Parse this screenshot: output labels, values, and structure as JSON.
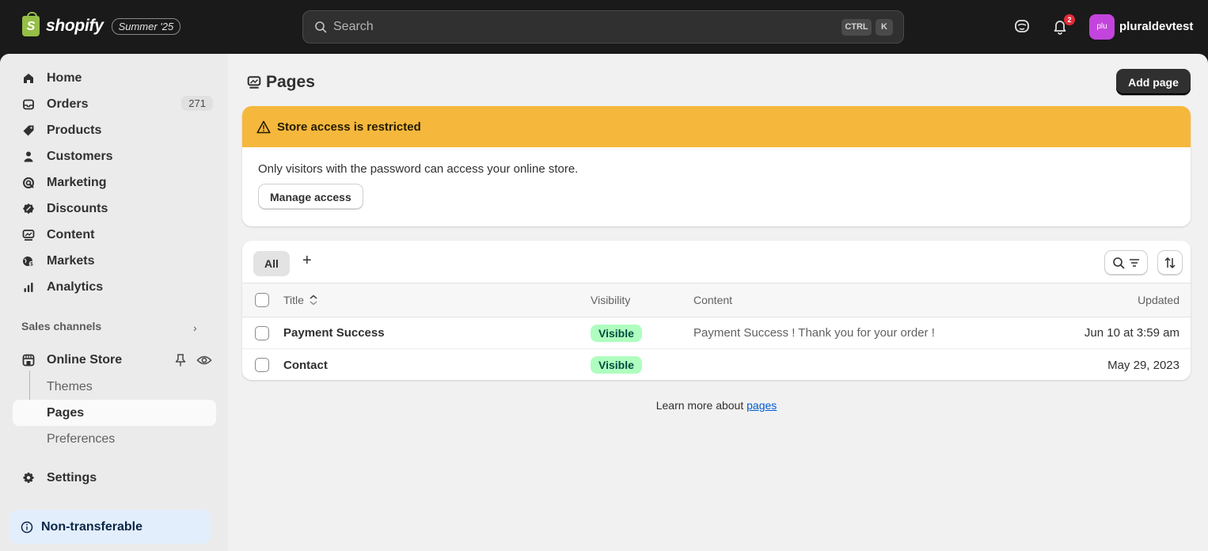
{
  "topbar": {
    "brand": "shopify",
    "brand_letter": "S",
    "edition_badge": "Summer '25",
    "search_placeholder": "Search",
    "shortcut_key1": "CTRL",
    "shortcut_key2": "K",
    "notification_count": "2",
    "avatar_initials": "plu",
    "username": "pluraldevtest"
  },
  "sidebar": {
    "items": [
      {
        "label": "Home",
        "icon": "home-icon"
      },
      {
        "label": "Orders",
        "icon": "inbox-icon",
        "count": "271"
      },
      {
        "label": "Products",
        "icon": "tag-icon"
      },
      {
        "label": "Customers",
        "icon": "person-icon"
      },
      {
        "label": "Marketing",
        "icon": "target-icon"
      },
      {
        "label": "Discounts",
        "icon": "discount-icon"
      },
      {
        "label": "Content",
        "icon": "content-icon"
      },
      {
        "label": "Markets",
        "icon": "globe-icon"
      },
      {
        "label": "Analytics",
        "icon": "bar-chart-icon"
      }
    ],
    "sales_channels_label": "Sales channels",
    "online_store": "Online Store",
    "sub_items": [
      "Themes",
      "Pages",
      "Preferences"
    ],
    "settings": "Settings",
    "non_transferable": "Non-transferable"
  },
  "main": {
    "title": "Pages",
    "add_button": "Add page",
    "banner": {
      "title": "Store access is restricted",
      "message": "Only visitors with the password can access your online store.",
      "button": "Manage access"
    },
    "table": {
      "tab_all": "All",
      "tab_add": "+",
      "headers": {
        "title": "Title",
        "visibility": "Visibility",
        "content": "Content",
        "updated": "Updated"
      },
      "rows": [
        {
          "title": "Payment Success",
          "visibility": "Visible",
          "content": "Payment Success ! Thank you for your order !",
          "updated": "Jun 10 at 3:59 am"
        },
        {
          "title": "Contact",
          "visibility": "Visible",
          "content": "",
          "updated": "May 29, 2023"
        }
      ]
    },
    "learn_more_text": "Learn more about ",
    "learn_more_link": "pages"
  },
  "colors": {
    "banner_warning": "#f5b83d",
    "visible_badge": "#affebf",
    "avatar": "#c344dc",
    "notification": "#e22c38",
    "link": "#005bd3"
  }
}
